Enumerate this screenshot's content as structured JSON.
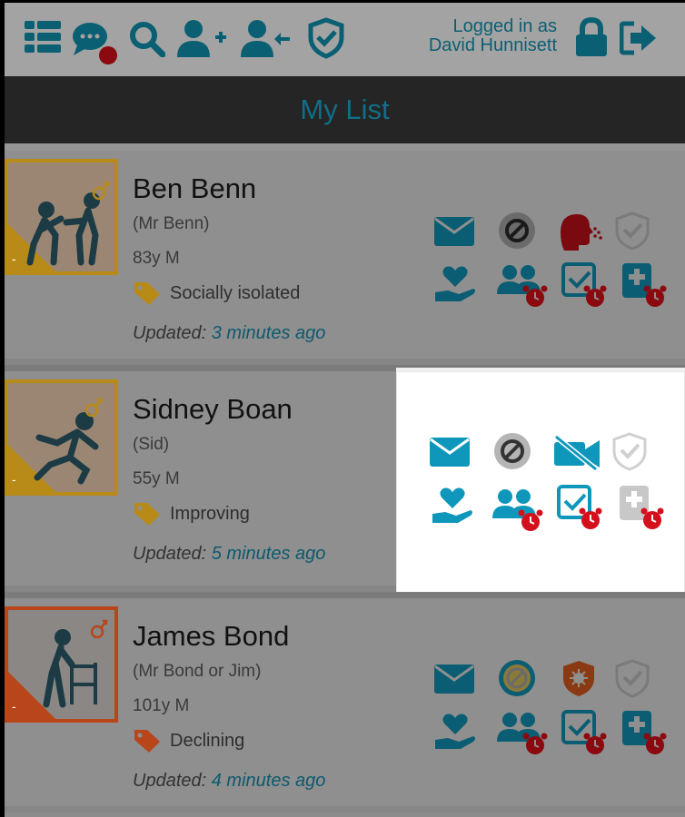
{
  "header": {
    "logged_in_line1": "Logged in as",
    "logged_in_line2": "David Hunnisett",
    "icons": [
      "list-icon",
      "chat-icon",
      "search-icon",
      "add-user-icon",
      "transfer-user-icon",
      "shield-check-icon",
      "lock-icon",
      "logout-icon"
    ]
  },
  "page": {
    "title": "My List"
  },
  "patients": [
    {
      "name": "Ben Benn",
      "nickname": "(Mr Benn)",
      "age_sex": "83y  M",
      "tag": "Socially isolated",
      "tag_color": "#b88a18",
      "updated_label": "Updated:",
      "updated_time": "3 minutes ago",
      "border_color": "#b88a18"
    },
    {
      "name": "Sidney Boan",
      "nickname": "(Sid)",
      "age_sex": "55y  M",
      "tag": "Improving",
      "tag_color": "#b88a18",
      "updated_label": "Updated:",
      "updated_time": "5 minutes ago",
      "border_color": "#b88a18"
    },
    {
      "name": "James Bond",
      "nickname": "(Mr Bond or Jim)",
      "age_sex": "101y  M",
      "tag": "Declining",
      "tag_color": "#b8461a",
      "updated_label": "Updated:",
      "updated_time": "4 minutes ago",
      "border_color": "#b8461a"
    }
  ],
  "colors": {
    "accent": "#0f8fb0",
    "alert": "#c0101a",
    "dim_overlay": "#8f8f8f",
    "highlight": "#ffffff"
  }
}
